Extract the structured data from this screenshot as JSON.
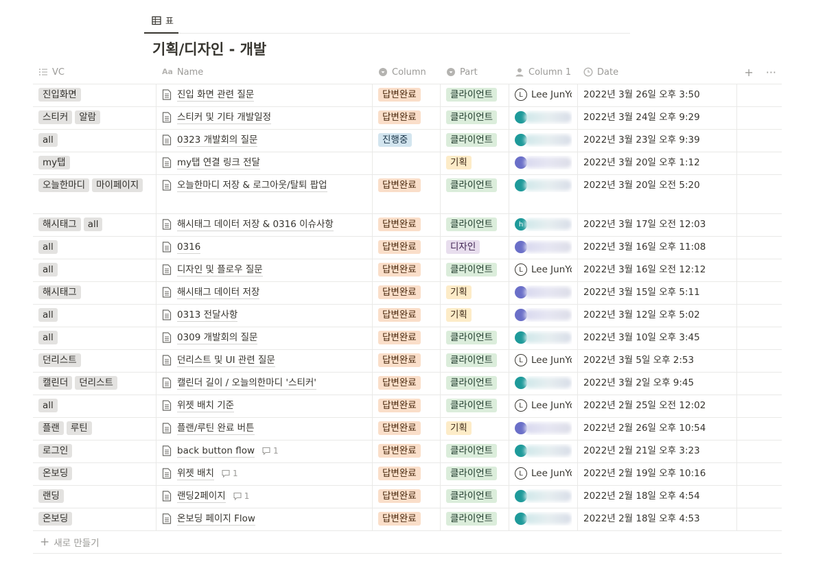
{
  "view_tab": {
    "label": "표",
    "icon": "table-icon"
  },
  "title": "기획/디자인 - 개발",
  "columns": [
    {
      "label": "VC",
      "icon": "list-icon"
    },
    {
      "label": "Name",
      "icon": "text-aa-icon"
    },
    {
      "label": "Column",
      "icon": "select-icon"
    },
    {
      "label": "Part",
      "icon": "select-icon"
    },
    {
      "label": "Column 1",
      "icon": "person-icon"
    },
    {
      "label": "Date",
      "icon": "clock-icon"
    }
  ],
  "header_actions": {
    "add": "+",
    "more": "···"
  },
  "rows": [
    {
      "vc": [
        "진입화면"
      ],
      "name": "진입 화면 관련 질문",
      "comments": "",
      "status": "답변완료",
      "part": "클라이언트",
      "person": {
        "avatar": "L",
        "name": "Lee JunYou"
      },
      "date": "2022년 3월 26일 오후 3:50"
    },
    {
      "vc": [
        "스티커",
        "알람"
      ],
      "name": "스티커 및 기타 개발일정",
      "comments": "",
      "status": "답변완료",
      "part": "클라이언트",
      "person": {
        "avatar": "",
        "name": ""
      },
      "date": "2022년 3월 24일 오후 9:29"
    },
    {
      "vc": [
        "all"
      ],
      "name": "0323 개발회의 질문",
      "comments": "",
      "status": "진행중",
      "part": "클라이언트",
      "person": {
        "avatar": "",
        "name": ""
      },
      "date": "2022년 3월 23일 오후 9:39"
    },
    {
      "vc": [
        "my탭"
      ],
      "name": "my탭 연결 링크 전달",
      "comments": "",
      "status": "",
      "part": "기획",
      "person": {
        "avatar": "",
        "name": ""
      },
      "date": "2022년 3월 20일 오후 1:12"
    },
    {
      "vc": [
        "오늘한마디",
        "마이페이지"
      ],
      "name": "오늘한마디 저장 & 로그아웃/탈퇴 팝업",
      "comments": "",
      "status": "답변완료",
      "part": "클라이언트",
      "person": {
        "avatar": "",
        "name": ""
      },
      "date": "2022년 3월 20일 오전 5:20"
    },
    {
      "vc": [
        "해시태그",
        "all"
      ],
      "name": "해시태그 데이터 저장 & 0316 이슈사항",
      "comments": "",
      "status": "답변완료",
      "part": "클라이언트",
      "person": {
        "avatar": "h",
        "name": ""
      },
      "date": "2022년 3월 17일 오전 12:03"
    },
    {
      "vc": [
        "all"
      ],
      "name": "0316",
      "comments": "",
      "status": "답변완료",
      "part": "디자인",
      "person": {
        "avatar": "",
        "name": ""
      },
      "date": "2022년 3월 16일 오후 11:08"
    },
    {
      "vc": [
        "all"
      ],
      "name": "디자인 및 플로우 질문",
      "comments": "",
      "status": "답변완료",
      "part": "클라이언트",
      "person": {
        "avatar": "L",
        "name": "Lee JunYou"
      },
      "date": "2022년 3월 16일 오전 12:12"
    },
    {
      "vc": [
        "해시태그"
      ],
      "name": "해시태그 데이터 저장",
      "comments": "",
      "status": "답변완료",
      "part": "기획",
      "person": {
        "avatar": "",
        "name": ""
      },
      "date": "2022년 3월 15일 오후 5:11"
    },
    {
      "vc": [
        "all"
      ],
      "name": "0313 전달사항",
      "comments": "",
      "status": "답변완료",
      "part": "기획",
      "person": {
        "avatar": "",
        "name": ""
      },
      "date": "2022년 3월 12일 오후 5:02"
    },
    {
      "vc": [
        "all"
      ],
      "name": "0309 개발회의 질문",
      "comments": "",
      "status": "답변완료",
      "part": "클라이언트",
      "person": {
        "avatar": "",
        "name": ""
      },
      "date": "2022년 3월 10일 오후 3:45"
    },
    {
      "vc": [
        "던리스트"
      ],
      "name": "던리스트 및 UI 관련 질문",
      "comments": "",
      "status": "답변완료",
      "part": "클라이언트",
      "person": {
        "avatar": "L",
        "name": "Lee JunYou"
      },
      "date": "2022년 3월 5일 오후 2:53"
    },
    {
      "vc": [
        "캘린더",
        "던리스트"
      ],
      "name": "캘린더 길이 / 오늘의한마디 '스티커'",
      "comments": "",
      "status": "답변완료",
      "part": "클라이언트",
      "person": {
        "avatar": "",
        "name": ""
      },
      "date": "2022년 3월 2일 오후 9:45"
    },
    {
      "vc": [
        "all"
      ],
      "name": "위젯 배치 기준",
      "comments": "",
      "status": "답변완료",
      "part": "클라이언트",
      "person": {
        "avatar": "L",
        "name": "Lee JunYou"
      },
      "date": "2022년 2월 25일 오전 12:02"
    },
    {
      "vc": [
        "플랜",
        "루틴"
      ],
      "name": "플랜/루틴 완료 버튼",
      "comments": "",
      "status": "답변완료",
      "part": "기획",
      "person": {
        "avatar": "",
        "name": ""
      },
      "date": "2022년 2월 26일 오후 10:54"
    },
    {
      "vc": [
        "로그인"
      ],
      "name": "back button flow",
      "comments": "1",
      "status": "답변완료",
      "part": "클라이언트",
      "person": {
        "avatar": "",
        "name": ""
      },
      "date": "2022년 2월 21일 오후 3:23"
    },
    {
      "vc": [
        "온보딩"
      ],
      "name": "위젯 배치",
      "comments": "1",
      "status": "답변완료",
      "part": "클라이언트",
      "person": {
        "avatar": "L",
        "name": "Lee JunYou"
      },
      "date": "2022년 2월 19일 오후 10:16"
    },
    {
      "vc": [
        "랜딩"
      ],
      "name": "랜딩2페이지",
      "comments": "1",
      "status": "답변완료",
      "part": "클라이언트",
      "person": {
        "avatar": "",
        "name": ""
      },
      "date": "2022년 2월 18일 오후 4:54"
    },
    {
      "vc": [
        "온보딩"
      ],
      "name": "온보딩 페이지 Flow",
      "comments": "",
      "status": "답변완료",
      "part": "클라이언트",
      "person": {
        "avatar": "",
        "name": ""
      },
      "date": "2022년 2월 18일 오후 4:53"
    }
  ],
  "new_row_label": "새로 만들기",
  "colors": {
    "status_done": "#fadec9",
    "status_progress": "#d3e5ef",
    "part_client": "#dbeddb",
    "part_plan": "#fdecc8",
    "part_design": "#e8deee"
  }
}
